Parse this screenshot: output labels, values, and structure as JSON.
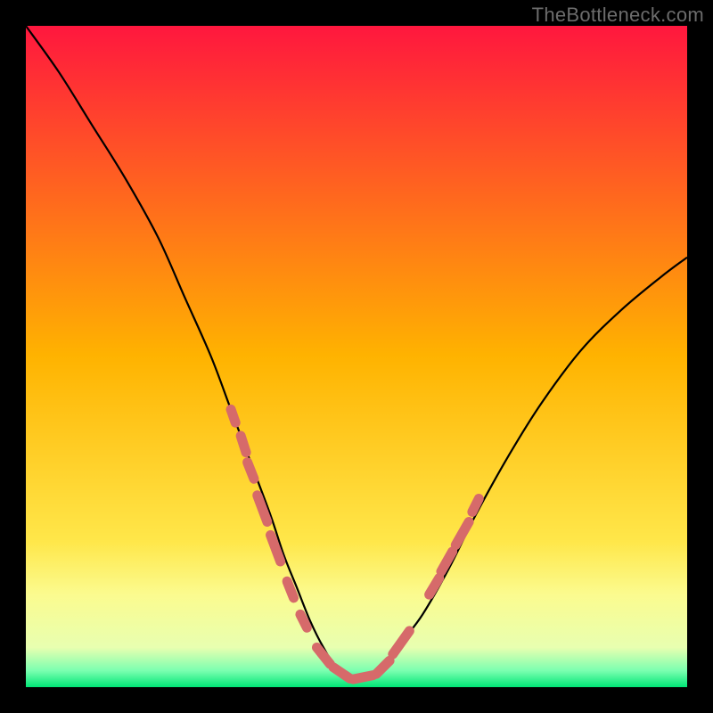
{
  "watermark": "TheBottleneck.com",
  "chart_data": {
    "type": "line",
    "title": "",
    "xlabel": "",
    "ylabel": "",
    "xlim": [
      0,
      100
    ],
    "ylim": [
      0,
      100
    ],
    "background_gradient": {
      "stops": [
        {
          "pos": 0.0,
          "color": "#ff173e"
        },
        {
          "pos": 0.5,
          "color": "#ffb300"
        },
        {
          "pos": 0.78,
          "color": "#ffe74a"
        },
        {
          "pos": 0.86,
          "color": "#fbfb8f"
        },
        {
          "pos": 0.94,
          "color": "#e8ffb0"
        },
        {
          "pos": 0.975,
          "color": "#7bffb0"
        },
        {
          "pos": 1.0,
          "color": "#00e676"
        }
      ]
    },
    "series": [
      {
        "name": "bottleneck-curve",
        "color": "#000000",
        "x": [
          0,
          5,
          10,
          15,
          20,
          24,
          28,
          31,
          34,
          37,
          39,
          41,
          43,
          45,
          47,
          50,
          53,
          55,
          57,
          60,
          64,
          68,
          73,
          78,
          84,
          90,
          96,
          100
        ],
        "y": [
          100,
          93,
          85,
          77,
          68,
          59,
          50,
          42,
          34,
          26,
          20,
          15,
          10,
          6,
          3,
          1,
          2,
          4,
          7,
          11,
          18,
          26,
          35,
          43,
          51,
          57,
          62,
          65
        ]
      }
    ],
    "markers": {
      "name": "highlight-segments",
      "color": "#d66a6a",
      "segments": [
        {
          "x1": 31.0,
          "y1": 42.0,
          "x2": 31.7,
          "y2": 40.0
        },
        {
          "x1": 32.5,
          "y1": 38.0,
          "x2": 33.3,
          "y2": 35.5
        },
        {
          "x1": 33.5,
          "y1": 34.0,
          "x2": 34.5,
          "y2": 31.5
        },
        {
          "x1": 35.0,
          "y1": 29.0,
          "x2": 36.5,
          "y2": 25.0
        },
        {
          "x1": 37.0,
          "y1": 23.0,
          "x2": 38.5,
          "y2": 19.0
        },
        {
          "x1": 39.5,
          "y1": 16.0,
          "x2": 40.5,
          "y2": 13.5
        },
        {
          "x1": 41.5,
          "y1": 11.0,
          "x2": 42.5,
          "y2": 9.0
        },
        {
          "x1": 44.0,
          "y1": 6.0,
          "x2": 46.0,
          "y2": 3.5
        },
        {
          "x1": 46.5,
          "y1": 3.0,
          "x2": 49.0,
          "y2": 1.3
        },
        {
          "x1": 49.5,
          "y1": 1.2,
          "x2": 52.5,
          "y2": 1.8
        },
        {
          "x1": 53.0,
          "y1": 2.0,
          "x2": 55.0,
          "y2": 4.0
        },
        {
          "x1": 55.5,
          "y1": 5.0,
          "x2": 58.0,
          "y2": 8.5
        },
        {
          "x1": 61.0,
          "y1": 14.0,
          "x2": 62.5,
          "y2": 16.5
        },
        {
          "x1": 62.8,
          "y1": 17.5,
          "x2": 64.5,
          "y2": 20.5
        },
        {
          "x1": 65.0,
          "y1": 21.5,
          "x2": 67.0,
          "y2": 25.0
        },
        {
          "x1": 67.5,
          "y1": 26.5,
          "x2": 68.5,
          "y2": 28.5
        }
      ]
    }
  }
}
